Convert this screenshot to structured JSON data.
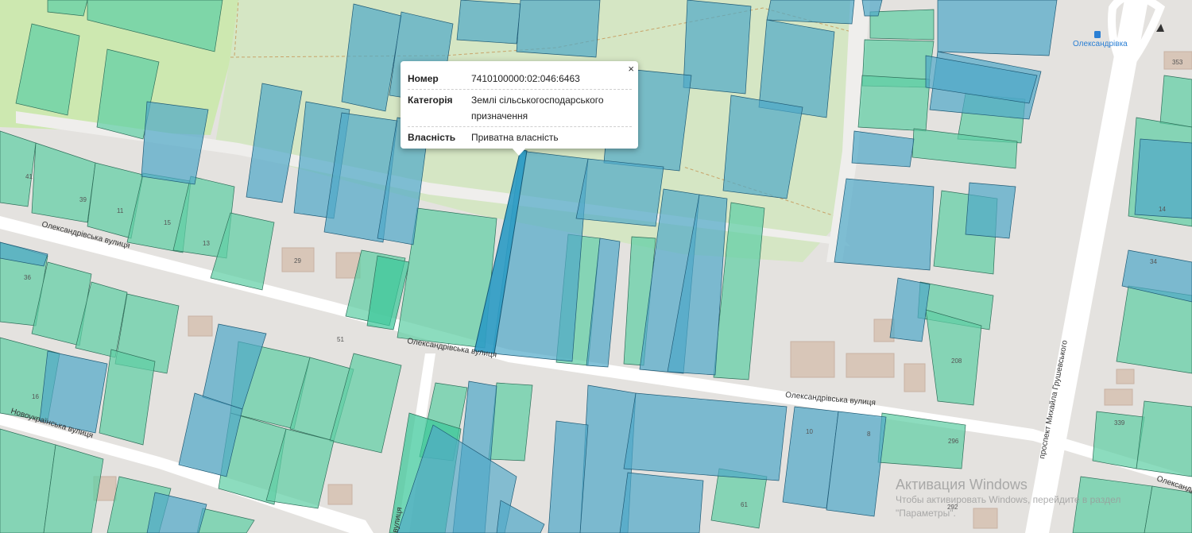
{
  "popup": {
    "close_label": "×",
    "rows": [
      {
        "key": "Номер",
        "value": "7410100000:02:046:6463"
      },
      {
        "key": "Категорія",
        "value": "Землі сільськогосподарського призначення"
      },
      {
        "key": "Власність",
        "value": "Приватна власність"
      }
    ]
  },
  "map_labels": {
    "streets": [
      "Олександрівська вулиця",
      "Олександрівська вулиця",
      "Олександрівська вулиця",
      "Олександрівська",
      "Новоукраїнська вулиця",
      "проспект Михайла Грушевського",
      "вулиця"
    ],
    "poi": "Олександрівка",
    "house_numbers": [
      "41",
      "11",
      "13",
      "29",
      "36",
      "16",
      "353",
      "208",
      "10",
      "8",
      "296",
      "339",
      "61",
      "292",
      "34",
      "14",
      "15",
      "39",
      "51"
    ]
  },
  "watermark": {
    "title": "Активация Windows",
    "line1": "Чтобы активировать Windows, перейдите в раздел",
    "line2": "\"Параметры\"."
  },
  "colors": {
    "parcel_green": "#5fcfa5",
    "parcel_blue": "#4ea8c7",
    "selected_parcel": "#2f9cc4",
    "farmland": "#cfe8b4",
    "road": "#ffffff"
  }
}
